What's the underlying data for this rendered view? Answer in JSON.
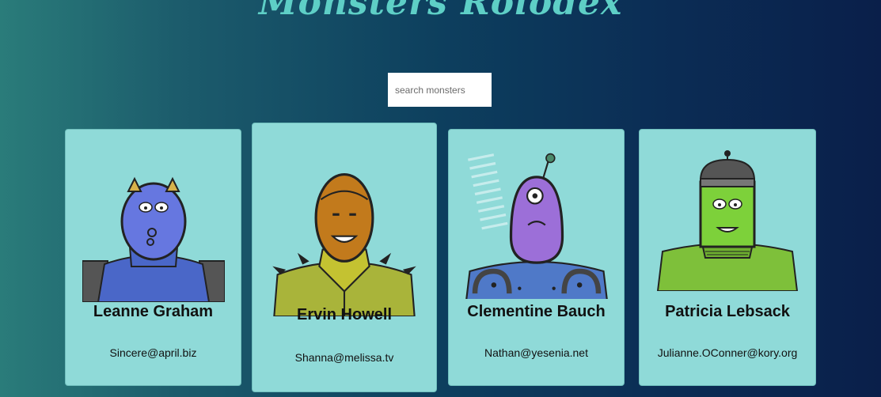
{
  "app": {
    "title": "Monsters Rolodex"
  },
  "search": {
    "placeholder": "search monsters",
    "value": ""
  },
  "monsters": [
    {
      "name": "Leanne Graham",
      "email": "Sincere@april.biz",
      "avatar_icon": "blue-horned-monster-icon"
    },
    {
      "name": "Ervin Howell",
      "email": "Shanna@melissa.tv",
      "avatar_icon": "orange-masked-monster-icon"
    },
    {
      "name": "Clementine Bauch",
      "email": "Nathan@yesenia.net",
      "avatar_icon": "purple-cyclops-robot-icon"
    },
    {
      "name": "Patricia Lebsack",
      "email": "Julianne.OConner@kory.org",
      "avatar_icon": "green-helmet-monster-icon"
    }
  ],
  "colors": {
    "title": "#5ecfc6",
    "card_background": "#8fdad8"
  }
}
